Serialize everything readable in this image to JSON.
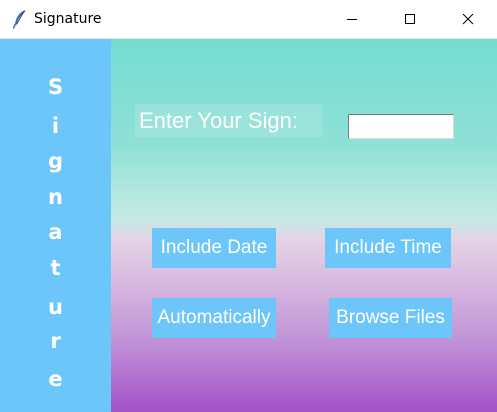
{
  "window": {
    "title": "Signature",
    "app_icon": "feather-icon",
    "controls": {
      "minimize": "minimize-icon",
      "maximize": "maximize-icon",
      "close": "close-icon"
    }
  },
  "sidebar": {
    "letters": [
      "S",
      "i",
      "g",
      "n",
      "a",
      "t",
      "u",
      "r",
      "e"
    ],
    "color": "#6cc6fa"
  },
  "main": {
    "sign_label": "Enter Your Sign:",
    "sign_input_value": "",
    "buttons": {
      "include_date": "Include Date",
      "include_time": "Include Time",
      "automatically": "Automatically",
      "browse_files": "Browse Files"
    },
    "button_color": "#6cc6fa",
    "gradient_top": "#74dcd2",
    "gradient_bottom": "#a451c8"
  }
}
